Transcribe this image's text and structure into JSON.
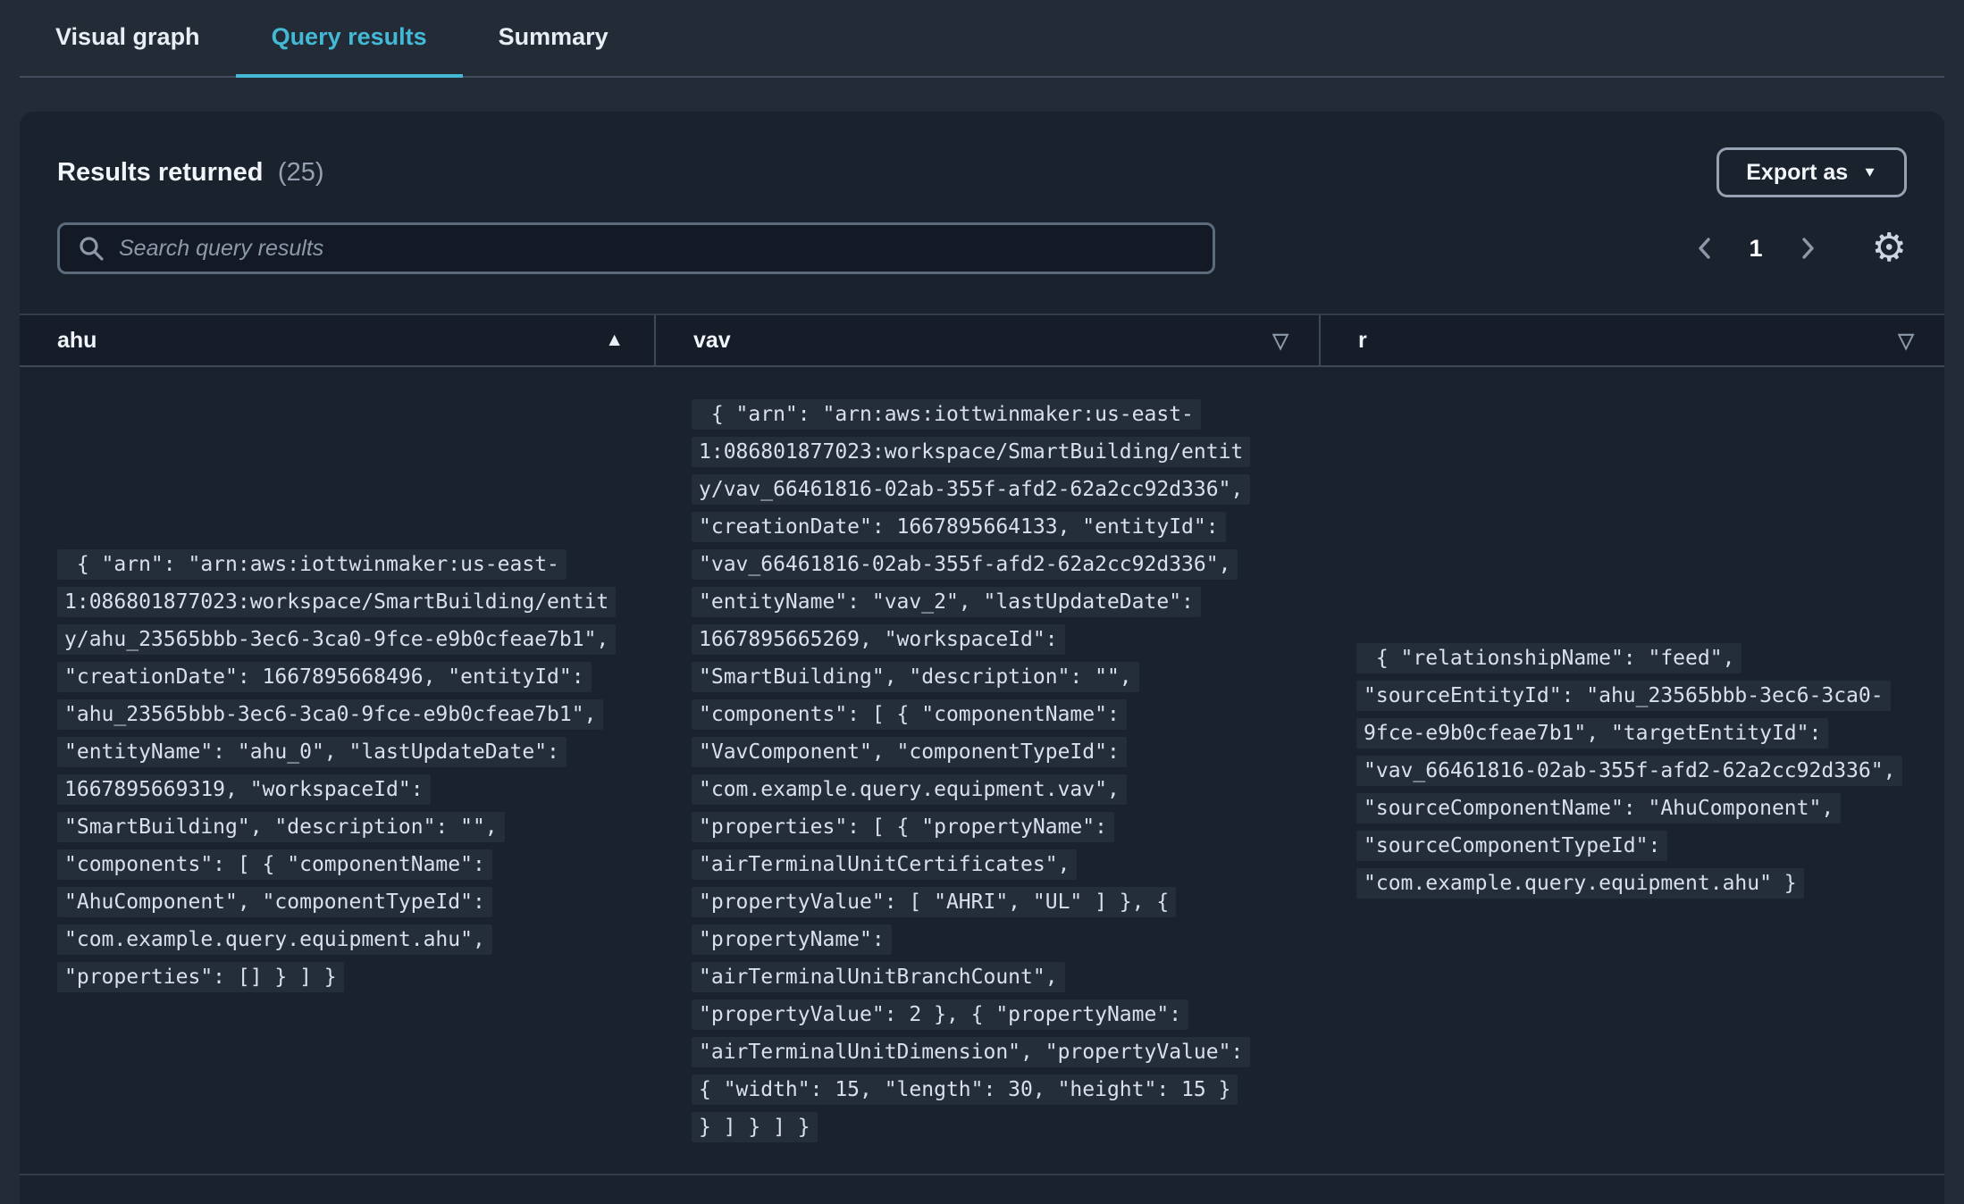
{
  "tabs": [
    {
      "label": "Visual graph",
      "active": false
    },
    {
      "label": "Query results",
      "active": true
    },
    {
      "label": "Summary",
      "active": false
    }
  ],
  "results_panel": {
    "title": "Results returned",
    "count": "(25)",
    "export_button_label": "Export as",
    "search_placeholder": "Search query results",
    "page_number": "1"
  },
  "icons": {
    "gear": "⚙",
    "caret_down": "▼",
    "sort_ascending": "▲",
    "sort_indicator": "▽"
  },
  "colors": {
    "accent_teal": "#43b9d6",
    "page_background": "#232b37",
    "panel_background": "#1a222e",
    "header_row_background": "#161d28",
    "code_line_background": "#242d3a",
    "text_primary": "#f1f5f9",
    "text_secondary": "#95a1b1"
  },
  "table": {
    "columns": [
      {
        "label": "ahu",
        "sort": "ascending"
      },
      {
        "label": "vav",
        "sort": "none"
      },
      {
        "label": "r",
        "sort": "none"
      }
    ],
    "row": {
      "ahu_lines": [
        " { \"arn\": \"arn:aws:iottwinmaker:us-east-",
        "1:086801877023:workspace/SmartBuilding/entit",
        "y/ahu_23565bbb-3ec6-3ca0-9fce-e9b0cfeae7b1\",",
        "\"creationDate\": 1667895668496, \"entityId\":",
        "\"ahu_23565bbb-3ec6-3ca0-9fce-e9b0cfeae7b1\",",
        "\"entityName\": \"ahu_0\", \"lastUpdateDate\":",
        "1667895669319, \"workspaceId\":",
        "\"SmartBuilding\", \"description\": \"\",",
        "\"components\": [ { \"componentName\":",
        "\"AhuComponent\", \"componentTypeId\":",
        "\"com.example.query.equipment.ahu\",",
        "\"properties\": [] } ] }"
      ],
      "vav_lines": [
        " { \"arn\": \"arn:aws:iottwinmaker:us-east-",
        "1:086801877023:workspace/SmartBuilding/entit",
        "y/vav_66461816-02ab-355f-afd2-62a2cc92d336\",",
        "\"creationDate\": 1667895664133, \"entityId\":",
        "\"vav_66461816-02ab-355f-afd2-62a2cc92d336\",",
        "\"entityName\": \"vav_2\", \"lastUpdateDate\":",
        "1667895665269, \"workspaceId\":",
        "\"SmartBuilding\", \"description\": \"\",",
        "\"components\": [ { \"componentName\":",
        "\"VavComponent\", \"componentTypeId\":",
        "\"com.example.query.equipment.vav\",",
        "\"properties\": [ { \"propertyName\":",
        "\"airTerminalUnitCertificates\",",
        "\"propertyValue\": [ \"AHRI\", \"UL\" ] }, {",
        "\"propertyName\":",
        "\"airTerminalUnitBranchCount\",",
        "\"propertyValue\": 2 }, { \"propertyName\":",
        "\"airTerminalUnitDimension\", \"propertyValue\":",
        "{ \"width\": 15, \"length\": 30, \"height\": 15 }",
        "} ] } ] }"
      ],
      "r_lines": [
        " { \"relationshipName\": \"feed\",",
        "\"sourceEntityId\": \"ahu_23565bbb-3ec6-3ca0-",
        "9fce-e9b0cfeae7b1\", \"targetEntityId\":",
        "\"vav_66461816-02ab-355f-afd2-62a2cc92d336\",",
        "\"sourceComponentName\": \"AhuComponent\",",
        "\"sourceComponentTypeId\":",
        "\"com.example.query.equipment.ahu\" }"
      ]
    }
  }
}
